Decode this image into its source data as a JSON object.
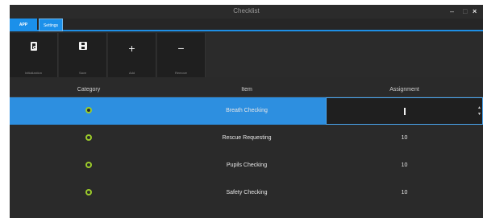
{
  "window": {
    "title": "Checklist",
    "minimize_label": "–",
    "maximize_label": "□",
    "close_label": "×"
  },
  "tabs": [
    {
      "label": "APP"
    },
    {
      "label": "Settings"
    }
  ],
  "ribbon": {
    "buttons": [
      {
        "label": "Initialization",
        "icon": "document-icon"
      },
      {
        "label": "Save",
        "icon": "save-icon"
      },
      {
        "label": "Add",
        "icon": "+"
      },
      {
        "label": "Remove",
        "icon": "−"
      }
    ]
  },
  "grid": {
    "headers": {
      "category": "Category",
      "item": "Item",
      "assignment": "Assignment"
    },
    "rows": [
      {
        "item": "Breath Checking",
        "assignment": "",
        "selected": true
      },
      {
        "item": "Rescue Requesting",
        "assignment": "10",
        "selected": false
      },
      {
        "item": "Pupils Checking",
        "assignment": "10",
        "selected": false
      },
      {
        "item": "Safety Checking",
        "assignment": "10",
        "selected": false
      }
    ],
    "status_color": "#9ccc2b",
    "selection_color": "#2d8fe0"
  },
  "accent": "#1b90ea"
}
